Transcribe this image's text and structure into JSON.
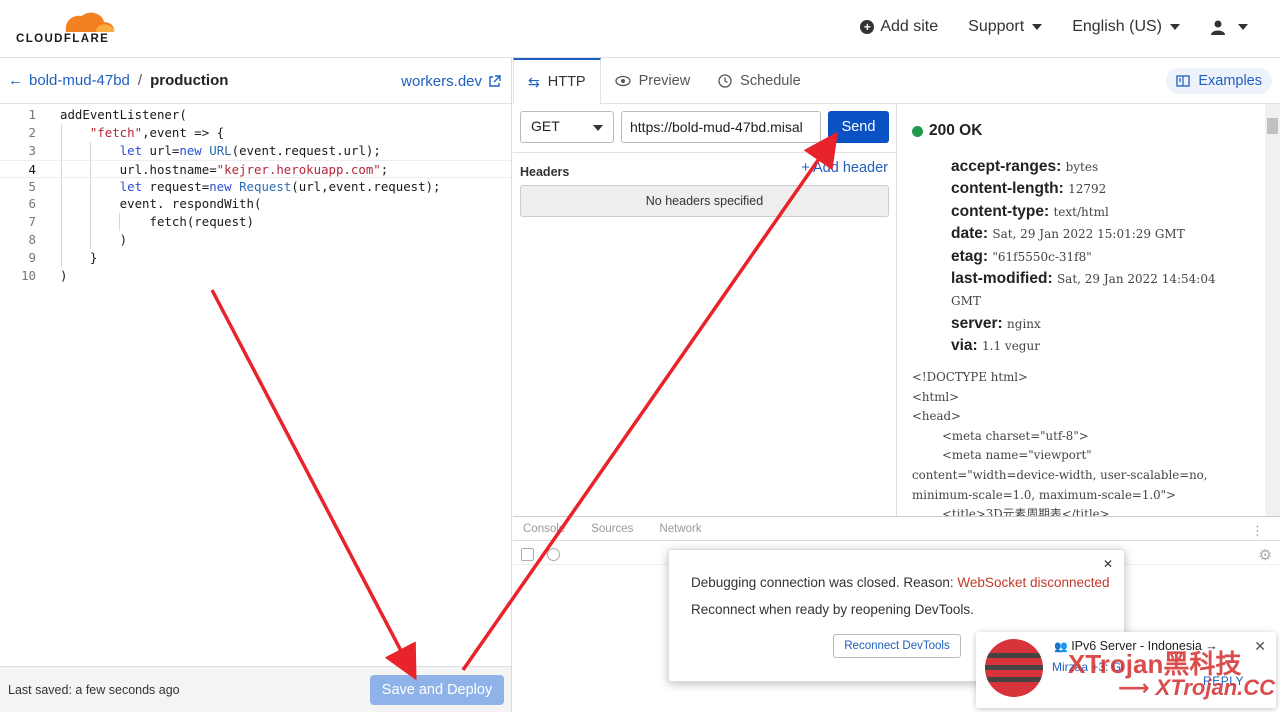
{
  "brand": {
    "name": "CLOUDFLARE"
  },
  "topnav": {
    "add_site": "Add site",
    "support": "Support",
    "language": "English (US)"
  },
  "editor": {
    "back_label": "bold-mud-47bd",
    "separator": "/",
    "env": "production",
    "workers_link": "workers.dev",
    "line_numbers": [
      "1",
      "2",
      "3",
      "4",
      "5",
      "6",
      "7",
      "8",
      "9",
      "10"
    ],
    "footer_saved": "Last saved: a few seconds ago",
    "deploy_label": "Save and Deploy"
  },
  "tabs": {
    "http": "HTTP",
    "preview": "Preview",
    "schedule": "Schedule",
    "examples": "Examples"
  },
  "request": {
    "method": "GET",
    "url": "https://bold-mud-47bd.misal",
    "send": "Send",
    "headers_label": "Headers",
    "add_header": "+ Add header",
    "no_headers": "No headers specified"
  },
  "response": {
    "status": "200 OK",
    "headers": [
      {
        "name": "accept-ranges:",
        "value": "bytes"
      },
      {
        "name": "content-length:",
        "value": "12792"
      },
      {
        "name": "content-type:",
        "value": "text/html"
      },
      {
        "name": "date:",
        "value": "Sat, 29 Jan 2022 15:01:29 GMT"
      },
      {
        "name": "etag:",
        "value": "\"61f5550c-31f8\""
      },
      {
        "name": "last-modified:",
        "value": "Sat, 29 Jan 2022 14:54:04 GMT"
      },
      {
        "name": "server:",
        "value": "nginx"
      },
      {
        "name": "via:",
        "value": "1.1 vegur"
      }
    ],
    "body": "<!DOCTYPE html>\n<html>\n<head>\n        <meta charset=\"utf-8\">\n        <meta name=\"viewport\"\ncontent=\"width=device-width, user-scalable=no,\nminimum-scale=1.0, maximum-scale=1.0\">\n        <title>3D元素周期表</title>"
  },
  "devtools": {
    "tabs": [
      "Console",
      "Sources",
      "Network"
    ],
    "popup_line1_prefix": "Debugging connection was closed. Reason: ",
    "popup_line1_reason": "WebSocket disconnected",
    "popup_line2": "Reconnect when ready by reopening DevTools.",
    "reconnect": "Reconnect DevTools"
  },
  "notification": {
    "title": "IPv6 Server - Indonesia →",
    "user": "Mirzaa +3: Gi",
    "reply": "REPLY"
  },
  "watermark": {
    "line1": "XTrojan黑科技",
    "line2": "XTrojan.CC"
  },
  "colors": {
    "accent": "#1f5fbf",
    "send": "#0a51c4",
    "ok": "#1f9a4b",
    "annotation": "#e8232a"
  }
}
